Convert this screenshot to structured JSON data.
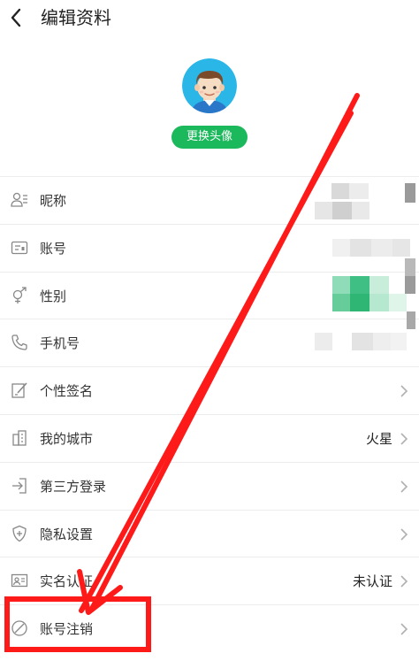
{
  "header": {
    "title": "编辑资料",
    "back_icon": "chevron-left-icon"
  },
  "profile": {
    "change_avatar_label": "更换头像",
    "accent_color": "#1cb85c"
  },
  "rows": [
    {
      "label": "昵称",
      "icon": "user-card-icon",
      "value": ""
    },
    {
      "label": "账号",
      "icon": "id-card-icon",
      "value": ""
    },
    {
      "label": "性别",
      "icon": "gender-icon",
      "value": ""
    },
    {
      "label": "手机号",
      "icon": "phone-icon",
      "value": ""
    },
    {
      "label": "个性签名",
      "icon": "edit-icon",
      "value": ""
    },
    {
      "label": "我的城市",
      "icon": "building-icon",
      "value": "火星"
    },
    {
      "label": "第三方登录",
      "icon": "login-icon",
      "value": ""
    },
    {
      "label": "隐私设置",
      "icon": "shield-icon",
      "value": ""
    },
    {
      "label": "实名认证",
      "icon": "id-photo-icon",
      "value": "未认证"
    },
    {
      "label": "账号注销",
      "icon": "prohibit-icon",
      "value": ""
    }
  ],
  "annotation": {
    "color": "#ff1a1a"
  }
}
